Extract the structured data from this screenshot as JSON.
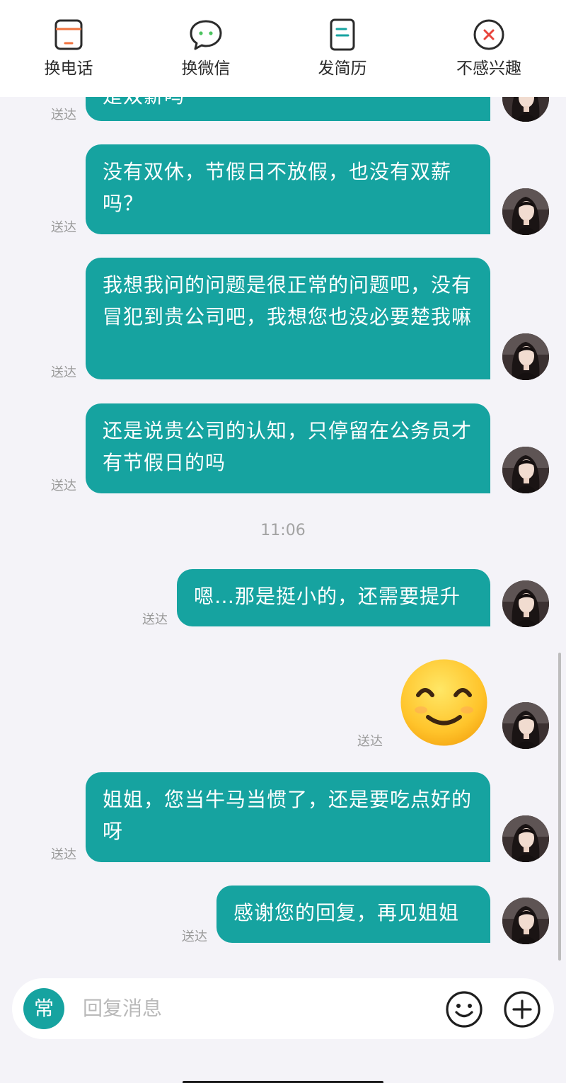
{
  "toolbar": {
    "phone_label": "换电话",
    "wechat_label": "换微信",
    "resume_label": "发简历",
    "not_interested_label": "不感兴趣"
  },
  "messages": [
    {
      "text": "是双薪吗",
      "status": "送达"
    },
    {
      "text": "没有双休，节假日不放假，也没有双薪吗？",
      "status": "送达"
    },
    {
      "text": "我想我问的问题是很正常的问题吧，没有冒犯到贵公司吧，我想您也没必要楚我嘛",
      "status": "送达"
    },
    {
      "text": "还是说贵公司的认知，只停留在公务员才有节假日的吗",
      "status": "送达"
    },
    {
      "text": "嗯…那是挺小的，还需要提升",
      "status": "送达"
    },
    {
      "emoji": "smiling-face",
      "status": "送达"
    },
    {
      "text": "姐姐，您当牛马当惯了，还是要吃点好的呀",
      "status": "送达"
    },
    {
      "text": "感谢您的回复，再见姐姐",
      "status": "送达"
    }
  ],
  "timestamp": "11:06",
  "composer": {
    "quick_phrase_label": "常",
    "placeholder": "回复消息"
  },
  "colors": {
    "bubble": "#16a3a0",
    "background": "#f4f3f8",
    "accent_red": "#e8443c",
    "accent_green": "#4cc35f",
    "accent_orange": "#f0733e"
  },
  "icons": [
    "phone-card-icon",
    "wechat-bubble-icon",
    "resume-doc-icon",
    "close-circle-icon",
    "emoji-icon",
    "plus-icon"
  ]
}
